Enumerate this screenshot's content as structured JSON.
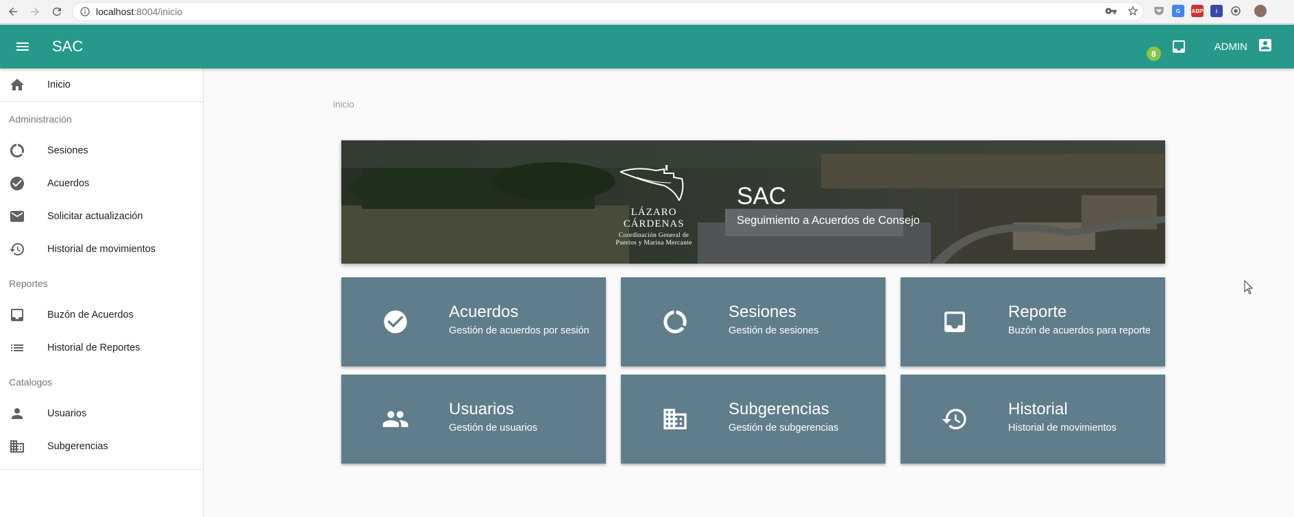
{
  "browser": {
    "url_host": "localhost",
    "url_path": ":8004/inicio",
    "extensions": [
      "pocket-icon",
      "translate-icon",
      "adblock-icon",
      "info-ext-icon",
      "target-ext-icon",
      "profile-avatar"
    ],
    "adblock_label": "ABP"
  },
  "header": {
    "title": "SAC",
    "notification_count": "8",
    "user": "ADMIN",
    "color": "#26998a"
  },
  "sidebar": {
    "home": {
      "label": "Inicio",
      "icon": "home-icon"
    },
    "sections": [
      {
        "title": "Administración",
        "items": [
          {
            "label": "Sesiones",
            "icon": "donut-icon"
          },
          {
            "label": "Acuerdos",
            "icon": "check-circle-icon"
          },
          {
            "label": "Solicitar actualización",
            "icon": "mail-icon"
          },
          {
            "label": "Historial de movimientos",
            "icon": "history-icon"
          }
        ]
      },
      {
        "title": "Reportes",
        "items": [
          {
            "label": "Buzón de Acuerdos",
            "icon": "inbox-icon"
          },
          {
            "label": "Historial de Reportes",
            "icon": "list-icon"
          }
        ]
      },
      {
        "title": "Catalogos",
        "items": [
          {
            "label": "Usuarios",
            "icon": "person-icon"
          },
          {
            "label": "Subgerencias",
            "icon": "building-icon"
          }
        ]
      }
    ]
  },
  "main": {
    "breadcrumb": "inicio",
    "banner": {
      "logo_name": "LÁZARO CÁRDENAS",
      "logo_sub_1": "Coordinación General de",
      "logo_sub_2": "Puertos y Marina Mercante",
      "title": "SAC",
      "subtitle": "Seguimiento a Acuerdos de Consejo"
    },
    "cards": [
      {
        "title": "Acuerdos",
        "subtitle": "Gestión de acuerdos por sesión",
        "icon": "check-circle-icon"
      },
      {
        "title": "Sesiones",
        "subtitle": "Gestión de sesiones",
        "icon": "donut-icon"
      },
      {
        "title": "Reporte",
        "subtitle": "Buzón de acuerdos para reporte",
        "icon": "inbox-icon"
      },
      {
        "title": "Usuarios",
        "subtitle": "Gestión de usuarios",
        "icon": "group-icon"
      },
      {
        "title": "Subgerencias",
        "subtitle": "Gestión de subgerencias",
        "icon": "building-icon"
      },
      {
        "title": "Historial",
        "subtitle": "Historial de movimientos",
        "icon": "history-icon"
      }
    ],
    "card_color": "#607d8b"
  }
}
